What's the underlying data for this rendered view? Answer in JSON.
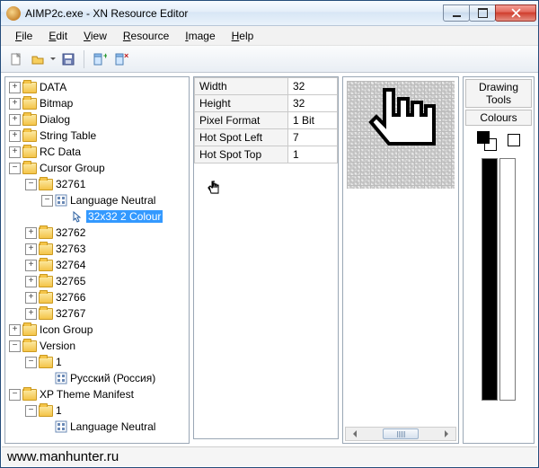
{
  "window": {
    "title": "AIMP2c.exe - XN Resource Editor"
  },
  "menu": {
    "file": "File",
    "edit": "Edit",
    "view": "View",
    "resource": "Resource",
    "image": "Image",
    "help": "Help"
  },
  "tree": {
    "data": "DATA",
    "bitmap": "Bitmap",
    "dialog": "Dialog",
    "string_table": "String Table",
    "rc_data": "RC Data",
    "cursor_group": "Cursor Group",
    "c32761": "32761",
    "lang_neutral": "Language Neutral",
    "sel": "32x32 2 Colour",
    "c32762": "32762",
    "c32763": "32763",
    "c32764": "32764",
    "c32765": "32765",
    "c32766": "32766",
    "c32767": "32767",
    "icon_group": "Icon Group",
    "version": "Version",
    "v1": "1",
    "ru": "Русский (Россия)",
    "xp": "XP Theme Manifest",
    "x1": "1",
    "xln": "Language Neutral"
  },
  "props": {
    "width_l": "Width",
    "width_v": "32",
    "height_l": "Height",
    "height_v": "32",
    "pf_l": "Pixel Format",
    "pf_v": "1 Bit",
    "hsl_l": "Hot Spot Left",
    "hsl_v": "7",
    "hst_l": "Hot Spot Top",
    "hst_v": "1"
  },
  "tools": {
    "drawing": "Drawing Tools",
    "colours": "Colours"
  },
  "status": {
    "text": "www.manhunter.ru"
  }
}
